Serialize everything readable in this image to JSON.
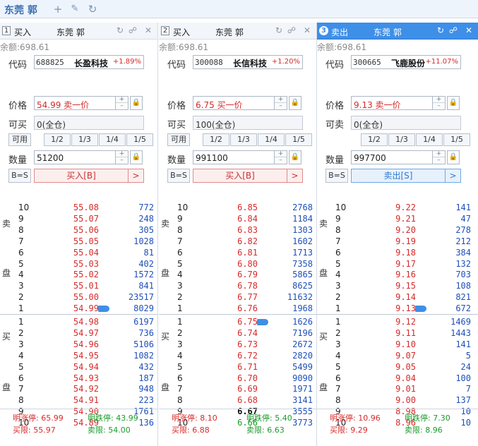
{
  "app": {
    "title": "东莞 郭"
  },
  "panels": [
    {
      "num": "1",
      "type": "买入",
      "account": "东莞 郭",
      "balance": "余额:698.61",
      "code": "688825",
      "name": "长盈科技",
      "pct": "+1.89%",
      "label_code": "代码",
      "label_price": "价格",
      "label_avail": "可买",
      "label_qty": "数量",
      "price": "54.99 卖一价",
      "avail": "0(全仓)",
      "avail_btn": "可用",
      "fractions": [
        "1/2",
        "1/3",
        "1/4",
        "1/5"
      ],
      "qty": "51200",
      "beqs": "B=S",
      "action": "买入[B]",
      "sell": [
        {
          "lv": "10",
          "p": "55.08",
          "q": "772"
        },
        {
          "lv": "9",
          "p": "55.07",
          "q": "248"
        },
        {
          "lv": "8",
          "p": "55.06",
          "q": "305"
        },
        {
          "lv": "7",
          "p": "55.05",
          "q": "1028"
        },
        {
          "lv": "6",
          "p": "55.04",
          "q": "81"
        },
        {
          "lv": "5",
          "p": "55.03",
          "q": "402"
        },
        {
          "lv": "4",
          "p": "55.02",
          "q": "1572"
        },
        {
          "lv": "3",
          "p": "55.01",
          "q": "841"
        },
        {
          "lv": "2",
          "p": "55.00",
          "q": "23517"
        },
        {
          "lv": "1",
          "p": "54.99",
          "q": "8029"
        }
      ],
      "buy": [
        {
          "lv": "1",
          "p": "54.98",
          "q": "6197"
        },
        {
          "lv": "2",
          "p": "54.97",
          "q": "736"
        },
        {
          "lv": "3",
          "p": "54.96",
          "q": "5106"
        },
        {
          "lv": "4",
          "p": "54.95",
          "q": "1082"
        },
        {
          "lv": "5",
          "p": "54.94",
          "q": "432"
        },
        {
          "lv": "6",
          "p": "54.93",
          "q": "187"
        },
        {
          "lv": "7",
          "p": "54.92",
          "q": "948"
        },
        {
          "lv": "8",
          "p": "54.91",
          "q": "223"
        },
        {
          "lv": "9",
          "p": "54.90",
          "q": "1761"
        },
        {
          "lv": "10",
          "p": "54.89",
          "q": "136"
        }
      ],
      "limit_up": "明涨停: 65.99",
      "limit_down": "明跌停: 43.99",
      "buy_limit": "买限: 55.97",
      "sell_limit": "卖限: 54.00"
    },
    {
      "num": "2",
      "type": "买入",
      "account": "东莞 郭",
      "balance": "余额:698.61",
      "code": "300088",
      "name": "长信科技",
      "pct": "+1.20%",
      "label_code": "代码",
      "label_price": "价格",
      "label_avail": "可买",
      "label_qty": "数量",
      "price": "6.75 买一价",
      "avail": "100(全仓)",
      "avail_btn": "可用",
      "fractions": [
        "1/2",
        "1/3",
        "1/4",
        "1/5"
      ],
      "qty": "991100",
      "beqs": "B=S",
      "action": "买入[B]",
      "sell": [
        {
          "lv": "10",
          "p": "6.85",
          "q": "2768"
        },
        {
          "lv": "9",
          "p": "6.84",
          "q": "1184"
        },
        {
          "lv": "8",
          "p": "6.83",
          "q": "1303"
        },
        {
          "lv": "7",
          "p": "6.82",
          "q": "1602"
        },
        {
          "lv": "6",
          "p": "6.81",
          "q": "1713"
        },
        {
          "lv": "5",
          "p": "6.80",
          "q": "7358"
        },
        {
          "lv": "4",
          "p": "6.79",
          "q": "5865"
        },
        {
          "lv": "3",
          "p": "6.78",
          "q": "8625"
        },
        {
          "lv": "2",
          "p": "6.77",
          "q": "11632"
        },
        {
          "lv": "1",
          "p": "6.76",
          "q": "1968"
        }
      ],
      "buy": [
        {
          "lv": "1",
          "p": "6.75",
          "q": "1626"
        },
        {
          "lv": "2",
          "p": "6.74",
          "q": "7196"
        },
        {
          "lv": "3",
          "p": "6.73",
          "q": "2672"
        },
        {
          "lv": "4",
          "p": "6.72",
          "q": "2820"
        },
        {
          "lv": "5",
          "p": "6.71",
          "q": "5499"
        },
        {
          "lv": "6",
          "p": "6.70",
          "q": "9090"
        },
        {
          "lv": "7",
          "p": "6.69",
          "q": "1971"
        },
        {
          "lv": "8",
          "p": "6.68",
          "q": "3141"
        },
        {
          "lv": "9",
          "p": "6.67",
          "q": "3555"
        },
        {
          "lv": "10",
          "p": "6.66",
          "q": "3773"
        }
      ],
      "limit_up": "明涨停: 8.10",
      "limit_down": "明跌停: 5.40",
      "buy_limit": "买限: 6.88",
      "sell_limit": "卖限: 6.63"
    },
    {
      "num": "3",
      "type": "卖出",
      "account": "东莞 郭",
      "balance": "余额:698.61",
      "code": "300665",
      "name": "飞鹿股份",
      "pct": "+11.07%",
      "label_code": "代码",
      "label_price": "价格",
      "label_avail": "可卖",
      "label_qty": "数量",
      "price": "9.13 卖一价",
      "avail": "0(全仓)",
      "avail_btn": "",
      "fractions": [
        "1/2",
        "1/3",
        "1/4",
        "1/5"
      ],
      "qty": "997700",
      "beqs": "B=S",
      "action": "卖出[S]",
      "sell": [
        {
          "lv": "10",
          "p": "9.22",
          "q": "141"
        },
        {
          "lv": "9",
          "p": "9.21",
          "q": "47"
        },
        {
          "lv": "8",
          "p": "9.20",
          "q": "278"
        },
        {
          "lv": "7",
          "p": "9.19",
          "q": "212"
        },
        {
          "lv": "6",
          "p": "9.18",
          "q": "384"
        },
        {
          "lv": "5",
          "p": "9.17",
          "q": "132"
        },
        {
          "lv": "4",
          "p": "9.16",
          "q": "703"
        },
        {
          "lv": "3",
          "p": "9.15",
          "q": "108"
        },
        {
          "lv": "2",
          "p": "9.14",
          "q": "821"
        },
        {
          "lv": "1",
          "p": "9.13",
          "q": "672"
        }
      ],
      "buy": [
        {
          "lv": "1",
          "p": "9.12",
          "q": "1469"
        },
        {
          "lv": "2",
          "p": "9.11",
          "q": "1443"
        },
        {
          "lv": "3",
          "p": "9.10",
          "q": "141"
        },
        {
          "lv": "4",
          "p": "9.07",
          "q": "5"
        },
        {
          "lv": "5",
          "p": "9.05",
          "q": "24"
        },
        {
          "lv": "6",
          "p": "9.04",
          "q": "100"
        },
        {
          "lv": "7",
          "p": "9.01",
          "q": "7"
        },
        {
          "lv": "8",
          "p": "9.00",
          "q": "137"
        },
        {
          "lv": "9",
          "p": "8.98",
          "q": "10"
        },
        {
          "lv": "10",
          "p": "8.96",
          "q": "10"
        }
      ],
      "limit_up": "明涨停: 10.96",
      "limit_down": "明跌停: 7.30",
      "buy_limit": "买限: 9.29",
      "sell_limit": "卖限: 8.96"
    }
  ],
  "book_labels": {
    "sell_top": "卖",
    "sell_bottom": "盘",
    "buy_top": "买",
    "buy_bottom": "盘"
  },
  "colors": {
    "accent": "#3d8fe8",
    "up": "#d62a2a",
    "down": "#1a9a2a",
    "volume": "#1e4fb8"
  }
}
